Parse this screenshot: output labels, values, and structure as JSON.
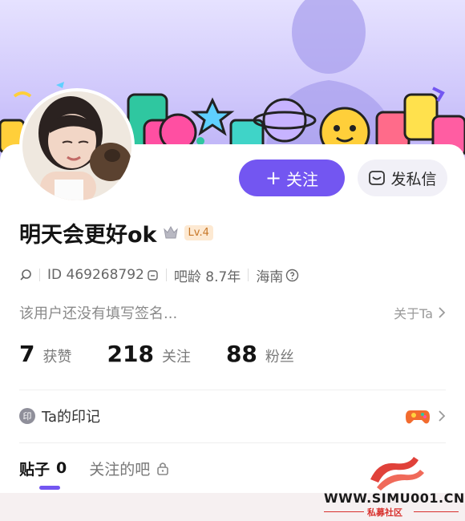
{
  "profile": {
    "username": "明天会更好ok",
    "level_badge": "Lv.4",
    "id_text": "ID 469268792",
    "bar_age": "吧龄 8.7年",
    "location": "海南",
    "bio": "该用户还没有填写签名...",
    "about_link": "关于Ta"
  },
  "actions": {
    "follow_label": "关注",
    "message_label": "发私信"
  },
  "stats": [
    {
      "value": "7",
      "label": "获赞"
    },
    {
      "value": "218",
      "label": "关注"
    },
    {
      "value": "88",
      "label": "粉丝"
    }
  ],
  "marks": {
    "icon_char": "印",
    "title": "Ta的印记"
  },
  "tabs": [
    {
      "label": "贴子",
      "count": "0"
    },
    {
      "label": "关注的吧"
    }
  ],
  "watermark": {
    "url": "WWW.SIMU001.CN",
    "subtitle": "私募社区"
  },
  "colors": {
    "accent": "#7356f1",
    "level_badge_bg": "#fde9d2",
    "level_badge_text": "#c77728",
    "watermark_red": "#d8302d"
  },
  "icons": [
    "crown-icon",
    "search-icon",
    "copy-icon",
    "help-icon",
    "chevron-right-icon",
    "message-icon",
    "lock-icon",
    "mark-icon",
    "game-controller-icon"
  ]
}
